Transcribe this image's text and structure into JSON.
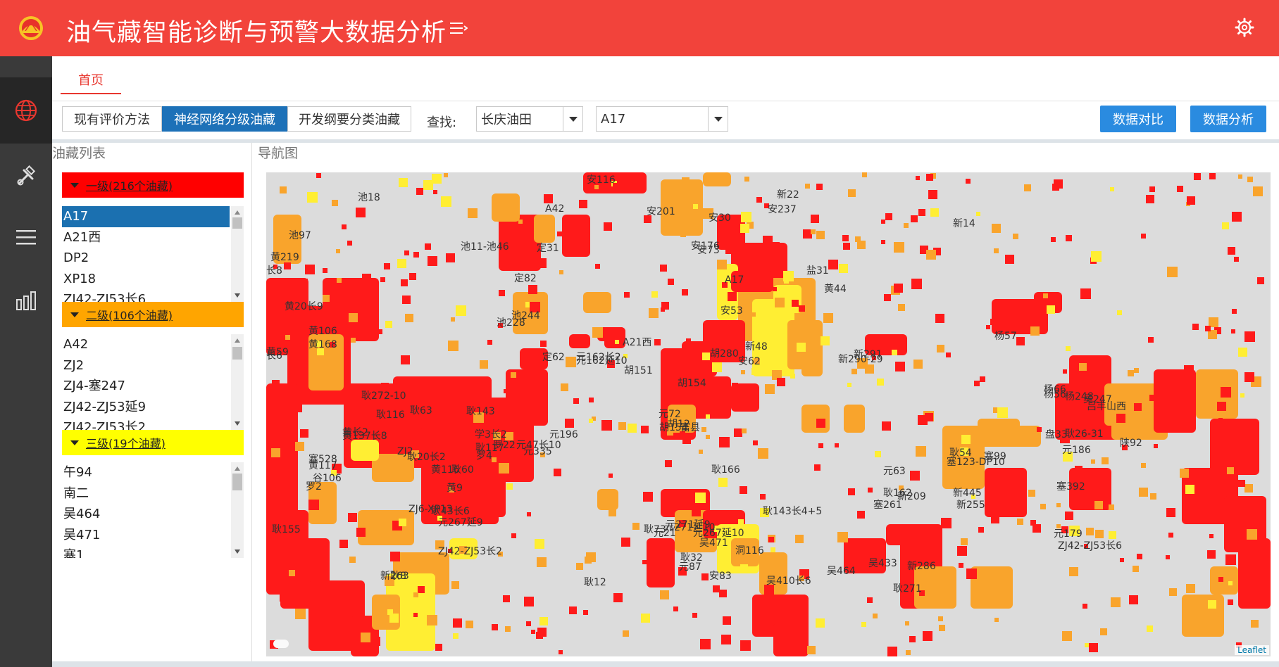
{
  "app": {
    "title": "油气藏智能诊断与预警大数据分析",
    "header_color": "#f2433b"
  },
  "sidebar": {
    "items": [
      {
        "name": "globe-icon",
        "active": true
      },
      {
        "name": "tools-icon",
        "active": false
      },
      {
        "name": "menu-icon",
        "active": false
      },
      {
        "name": "bar-chart-icon",
        "active": false
      }
    ]
  },
  "tabs": [
    {
      "label": "首页",
      "active": true
    }
  ],
  "toolbar": {
    "methods": [
      "现有评价方法",
      "神经网络分级油藏",
      "开发纲要分类油藏"
    ],
    "active_method": "神经网络分级油藏",
    "find_label": "查找:",
    "oilfield_select": "长庆油田",
    "reservoir_select": "A17",
    "compare_button": "数据对比",
    "analysis_button": "数据分析",
    "accent": "#1d71b8",
    "button_color": "#2a8be0"
  },
  "reservoir_list": {
    "title": "油藏列表",
    "levels": [
      {
        "label": "一级(216个油藏)",
        "color": "#ff0000",
        "items": [
          "A17",
          "A21西",
          "DP2",
          "XP18",
          "ZJ42-ZJ53长6"
        ],
        "selected": "A17"
      },
      {
        "label": "二级(106个油藏)",
        "color": "#ffa500",
        "items": [
          "A42",
          "ZJ2",
          "ZJ4-塞247",
          "ZJ42-ZJ53延9",
          "ZJ42-ZJ53长2"
        ]
      },
      {
        "label": "三级(19个油藏)",
        "color": "#ffff00",
        "items": [
          "午94",
          "南二",
          "吴464",
          "吴471",
          "塞1"
        ]
      }
    ]
  },
  "map": {
    "title": "导航图",
    "attribution": "Leaflet",
    "colors": {
      "level1": "#ff1a1a",
      "level2": "#f9a42c",
      "level3": "#ffee33",
      "background": "#dcdcdc"
    },
    "labels": [
      "安116",
      "池18",
      "A42",
      "安201",
      "新22",
      "安237",
      "安30",
      "新14",
      "池97",
      "池11-池46",
      "定31",
      "安176",
      "安73",
      "黄219",
      "盐31",
      "长8",
      "A17",
      "黄44",
      "定82",
      "安53",
      "黄20长9",
      "池244",
      "池228",
      "杨57",
      "黄106",
      "黄168",
      "A21西",
      "胡280",
      "新48",
      "黄59",
      "长6",
      "定62",
      "元162长2",
      "元162延10",
      "安62",
      "新291",
      "新290-29",
      "胡151",
      "胡154",
      "杨66",
      "杨56",
      "杨248",
      "吴247",
      "吕丰山西",
      "耿272-10",
      "耿116",
      "耿63",
      "耿143",
      "元72",
      "胡12",
      "胡154",
      "富县",
      "盘33",
      "耿26-31",
      "黄长2",
      "黄137长8",
      "元196",
      "学3长2",
      "耿117",
      "罗22",
      "元47长10",
      "元335",
      "元186",
      "陕92",
      "ZJ2",
      "耿20长2",
      "罗4",
      "耿54",
      "塞99",
      "塞123-DP10",
      "塞528",
      "黄117",
      "黄116",
      "耿60",
      "耿166",
      "元63",
      "谷106",
      "罗2",
      "黄9",
      "耿162",
      "新209",
      "新445",
      "塞261",
      "新255",
      "塞392",
      "ZJ6-XP13",
      "耿43长6",
      "耿143长4+5",
      "元267延9",
      "耿155",
      "耿73",
      "元21",
      "元271延9",
      "元271延10",
      "元267延10",
      "吴471",
      "洞116",
      "元179",
      "ZJ42-ZJ53长6",
      "ZJ42-ZJ53长2",
      "耿32",
      "元87",
      "安83",
      "吴464",
      "吴433",
      "新286",
      "新263",
      "耿8",
      "耿12",
      "耿271",
      "吴410长6"
    ]
  }
}
